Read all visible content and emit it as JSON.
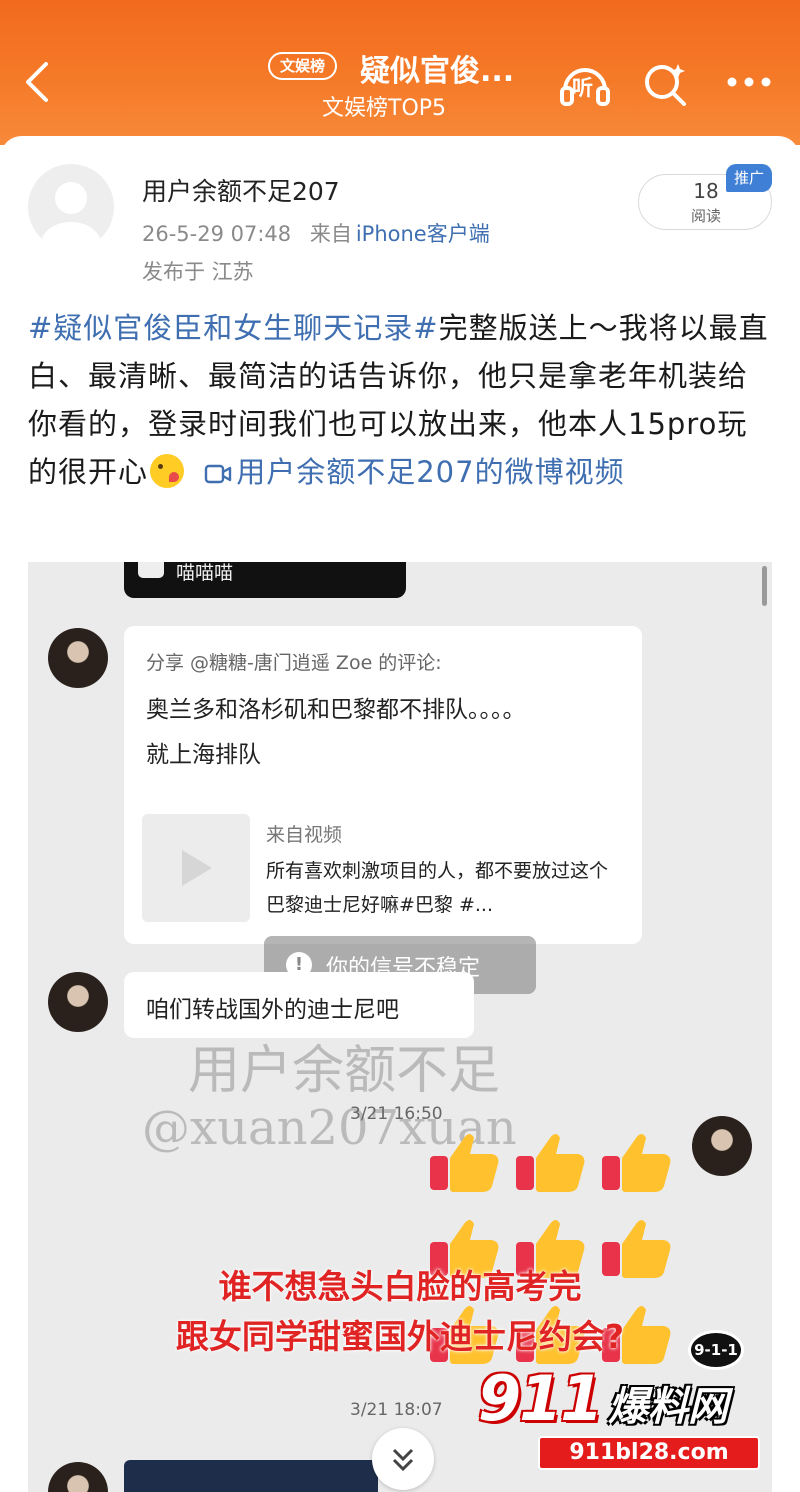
{
  "header": {
    "tag": "文娱榜",
    "title": "疑似官俊...",
    "subtitle": "文娱榜TOP5",
    "listen_label": "听"
  },
  "post": {
    "username": "用户余额不足207",
    "timestamp": "26-5-29 07:48",
    "from_prefix": "来自",
    "client": "iPhone客户端",
    "location": "发布于 江苏",
    "read_count": "18",
    "read_label": "阅读",
    "promo_badge": "推广",
    "hashtag": "#疑似官俊臣和女生聊天记录#",
    "body_text": "完整版送上～我将以最直白、最清晰、最简洁的话告诉你，他只是拿老年机装给你看的，登录时间我们也可以放出来，他本人15pro玩的很开心",
    "video_link": "用户余额不足207的微博视频"
  },
  "screenshot": {
    "top_bar_label": "喵喵喵",
    "share_head": "分享 @糖糖-唐门逍遥 Zoe 的评论:",
    "share_text": "奥兰多和洛杉矶和巴黎都不排队。。。。就上海排队",
    "from_video": "来自视频",
    "video_desc": "所有喜欢刺激项目的人，都不要放过这个巴黎迪士尼好嘛#巴黎 #...",
    "toast": "你的信号不稳定",
    "message": "咱们转战国外的迪士尼吧",
    "watermark_line1": "用户余额不足",
    "watermark_line2": "@xuan207xuan",
    "time_1": "3/21 16:50",
    "time_2": "3/21 18:07",
    "caption_line1": "谁不想急头白脸的高考完",
    "caption_line2": "跟女同学甜蜜国外迪士尼约会?"
  },
  "brand": {
    "main": "911",
    "cn": "爆料网",
    "url": "911bl28.com",
    "badge": "9-1-1"
  },
  "colors": {
    "header_orange": "#f57a28",
    "link_blue": "#3f6fb1",
    "caption_red": "#e02424"
  }
}
